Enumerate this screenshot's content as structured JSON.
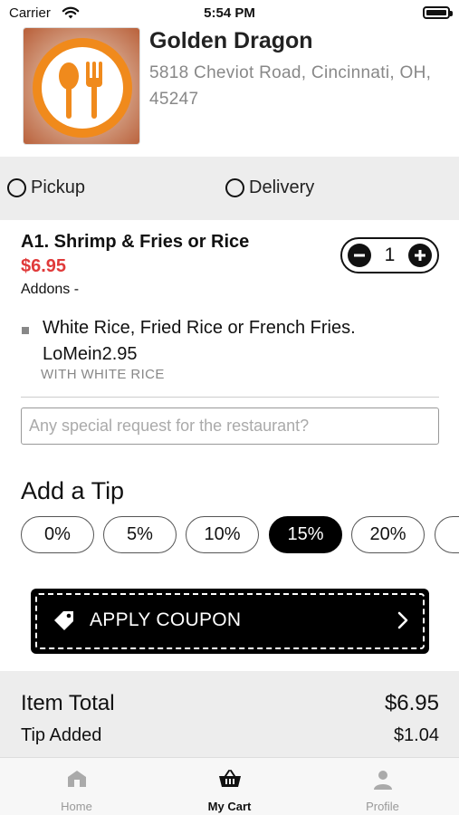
{
  "status_bar": {
    "carrier": "Carrier",
    "time": "5:54 PM"
  },
  "restaurant": {
    "name": "Golden Dragon",
    "address": "5818 Cheviot Road, Cincinnati, OH, 45247",
    "logo_colors": {
      "ring": "#f08a1c",
      "utensils": "#f08a1c"
    }
  },
  "order_type": {
    "options": [
      {
        "label": "Pickup",
        "selected": false
      },
      {
        "label": "Delivery",
        "selected": false
      }
    ]
  },
  "item": {
    "title": "A1. Shrimp & Fries or Rice",
    "price": "$6.95",
    "addons_label": "Addons -",
    "quantity": "1",
    "addon": {
      "name": "White Rice, Fried Rice or French Fries. LoMein2.95",
      "selection": "WITH WHITE RICE"
    }
  },
  "special_request": {
    "value": "",
    "placeholder": "Any special request for the restaurant?"
  },
  "tip": {
    "heading": "Add a Tip",
    "options": [
      "0%",
      "5%",
      "10%",
      "15%",
      "20%"
    ],
    "selected": "15%"
  },
  "coupon": {
    "label": "APPLY COUPON"
  },
  "totals": {
    "item_total_label": "Item Total",
    "item_total_value": "$6.95",
    "tip_label": "Tip Added",
    "tip_value": "$1.04"
  },
  "tab_bar": {
    "tabs": [
      {
        "label": "Home",
        "icon": "home-icon",
        "active": false
      },
      {
        "label": "My Cart",
        "icon": "basket-icon",
        "active": true
      },
      {
        "label": "Profile",
        "icon": "person-icon",
        "active": false
      }
    ]
  },
  "colors": {
    "price": "#e03a3a",
    "accent": "#000000",
    "section_bg": "#ededed"
  }
}
